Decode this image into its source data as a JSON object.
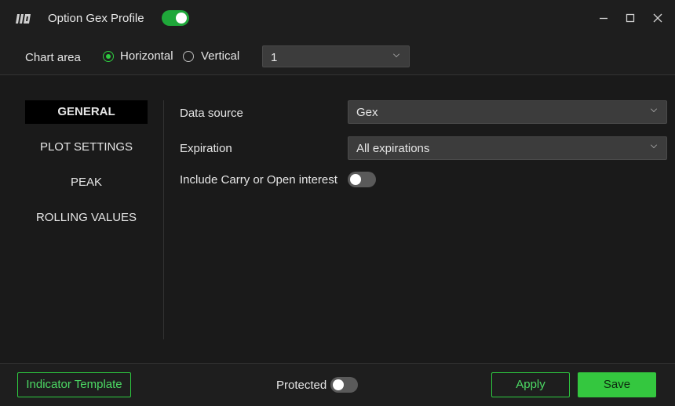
{
  "window": {
    "title": "Option Gex Profile",
    "enabled": true
  },
  "chart_area": {
    "label": "Chart area",
    "orientation_options": [
      "Horizontal",
      "Vertical"
    ],
    "selected_orientation": "Horizontal",
    "area_value": "1"
  },
  "sidebar": {
    "items": [
      {
        "label": "GENERAL",
        "active": true
      },
      {
        "label": "PLOT SETTINGS",
        "active": false
      },
      {
        "label": "PEAK",
        "active": false
      },
      {
        "label": "ROLLING VALUES",
        "active": false
      }
    ]
  },
  "general": {
    "data_source_label": "Data source",
    "data_source_value": "Gex",
    "expiration_label": "Expiration",
    "expiration_value": "All expirations",
    "include_carry_label": "Include Carry or Open interest",
    "include_carry_enabled": false
  },
  "footer": {
    "template_label": "Indicator Template",
    "protected_label": "Protected",
    "protected_enabled": false,
    "apply_label": "Apply",
    "save_label": "Save"
  },
  "colors": {
    "accent": "#34c73f",
    "background": "#1a1a1a",
    "field": "#3c3c3c"
  }
}
